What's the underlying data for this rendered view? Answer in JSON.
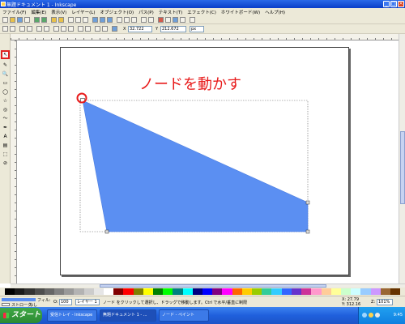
{
  "window": {
    "title": "無題ドキュメント 1 - Inkscape",
    "minimize": "_",
    "maximize": "□",
    "close": "×"
  },
  "menu": [
    "ファイル(F)",
    "編集(E)",
    "表示(V)",
    "レイヤー(L)",
    "オブジェクト(O)",
    "パス(P)",
    "テキスト(T)",
    "エフェクト(C)",
    "ホワイトボード(W)",
    "ヘルプ(H)"
  ],
  "toolbar2": {
    "x_label": "X",
    "x_value": "32.722",
    "y_label": "Y",
    "y_value": "212.672",
    "unit": "px"
  },
  "tools": [
    "↖",
    "✎",
    "🔍",
    "▭",
    "◯",
    "☆",
    "◎",
    "〜",
    "✒",
    "A",
    "▤",
    "⬚",
    "⊘"
  ],
  "canvas": {
    "annotation": "ノードを動かす",
    "shape_fill": "#5b8ff2",
    "annotation_color": "#e81b1b"
  },
  "palette": [
    "#000000",
    "#1a1a1a",
    "#333333",
    "#4d4d4d",
    "#666666",
    "#808080",
    "#999999",
    "#b3b3b3",
    "#cccccc",
    "#e6e6e6",
    "#ffffff",
    "#800000",
    "#ff0000",
    "#808000",
    "#ffff00",
    "#008000",
    "#00ff00",
    "#008080",
    "#00ffff",
    "#000080",
    "#0000ff",
    "#800080",
    "#ff00ff",
    "#ff6600",
    "#ffcc00",
    "#99cc00",
    "#33cc99",
    "#33ccff",
    "#3366ff",
    "#6633cc",
    "#cc3399",
    "#ff99cc",
    "#ffcc99",
    "#ffff99",
    "#ccffcc",
    "#ccffff",
    "#99ccff",
    "#cc99ff",
    "#996633",
    "#663300"
  ],
  "statusbar": {
    "fill_label": "フィル:",
    "stroke_label": "ストローク:",
    "stroke_value": "なし",
    "opacity_label": "O:",
    "opacity_value": "100",
    "layer": "レイヤー 1",
    "message": "ノード をクリックして選択し、ドラッグで移動します。Ctrl で水平/垂直に制限",
    "coord_x": "X: 27.79",
    "coord_y": "Y: 312.16",
    "zoom_label": "Z:",
    "zoom_value": "101%"
  },
  "taskbar": {
    "start": "スタート",
    "tasks": [
      "受信トレイ - Inkscape",
      "無題ドキュメント 1 - ...",
      "ノード - ペイント"
    ],
    "time": "9:45"
  }
}
